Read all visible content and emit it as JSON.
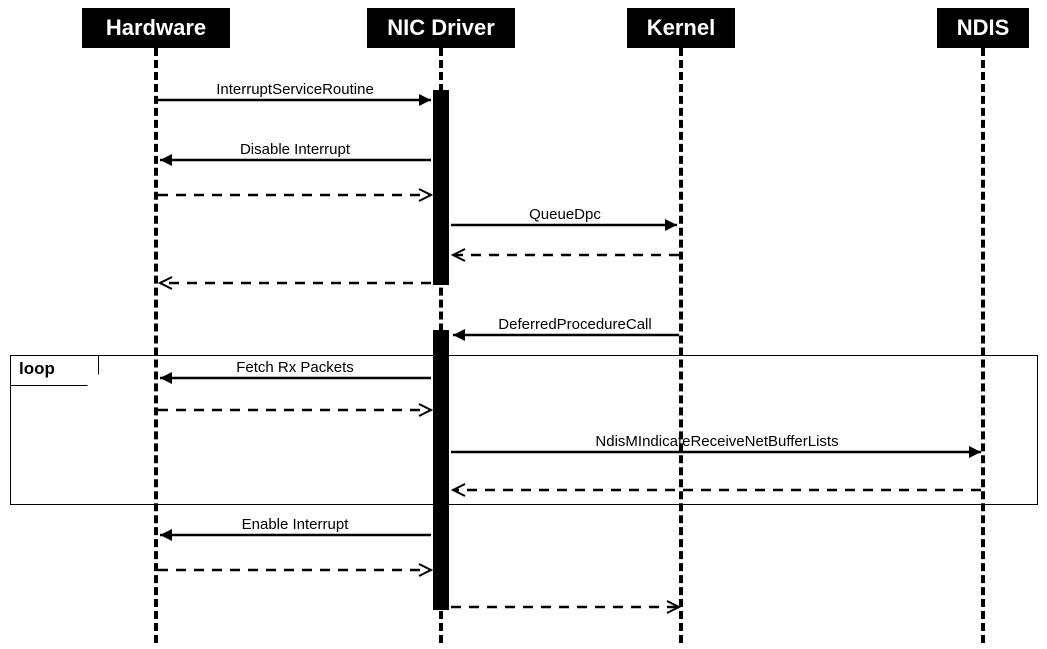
{
  "participants": {
    "hardware": "Hardware",
    "nic_driver": "NIC Driver",
    "kernel": "Kernel",
    "ndis": "NDIS"
  },
  "messages": {
    "isr": "InterruptServiceRoutine",
    "disable_int": "Disable Interrupt",
    "queue_dpc": "QueueDpc",
    "dpc": "DeferredProcedureCall",
    "fetch_rx": "Fetch Rx Packets",
    "ndis_indicate": "NdisMIndicateReceiveNetBufferLists",
    "enable_int": "Enable Interrupt"
  },
  "fragment": {
    "loop": "loop"
  }
}
